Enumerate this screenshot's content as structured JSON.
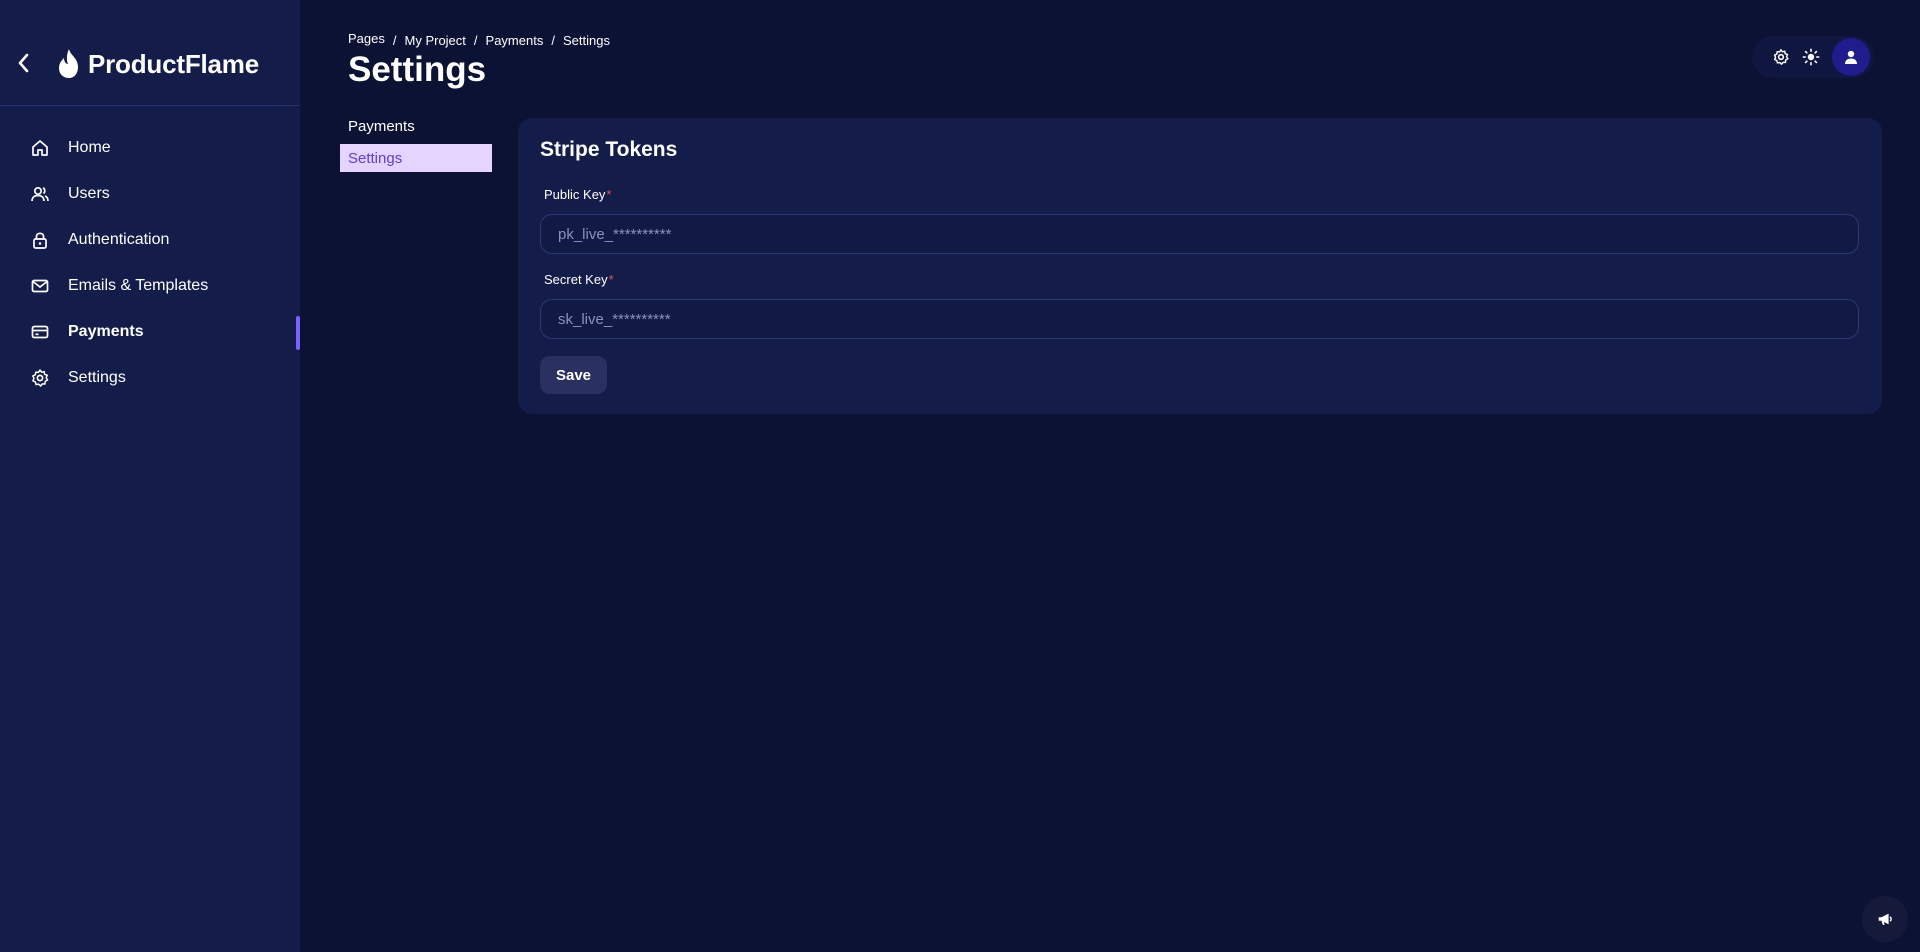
{
  "brand": {
    "name": "ProductFlame"
  },
  "sidebar": {
    "items": [
      {
        "label": "Home",
        "icon": "home-icon"
      },
      {
        "label": "Users",
        "icon": "users-icon"
      },
      {
        "label": "Authentication",
        "icon": "lock-icon"
      },
      {
        "label": "Emails & Templates",
        "icon": "mail-icon"
      },
      {
        "label": "Payments",
        "icon": "credit-card-icon",
        "active": true
      },
      {
        "label": "Settings",
        "icon": "gear-icon"
      }
    ]
  },
  "header": {
    "breadcrumb": [
      "Pages",
      "My Project",
      "Payments",
      "Settings"
    ],
    "breadcrumb_separator": "/",
    "title": "Settings"
  },
  "submenu": {
    "items": [
      {
        "label": "Payments"
      },
      {
        "label": "Settings",
        "active": true
      }
    ]
  },
  "card": {
    "title": "Stripe Tokens",
    "public_key": {
      "label": "Public Key",
      "required_mark": "*",
      "value": "",
      "placeholder": "pk_live_**********"
    },
    "secret_key": {
      "label": "Secret Key",
      "required_mark": "*",
      "value": "",
      "placeholder": "sk_live_**********"
    },
    "save_label": "Save"
  },
  "colors": {
    "background": "#0c1233",
    "sidebar": "#141c4a",
    "accent": "#7b61ff",
    "active_submenu_bg": "#e4d4ff",
    "active_submenu_text": "#5b3fd1",
    "required": "#e2505f",
    "avatar_bg": "#1f1c8e"
  }
}
